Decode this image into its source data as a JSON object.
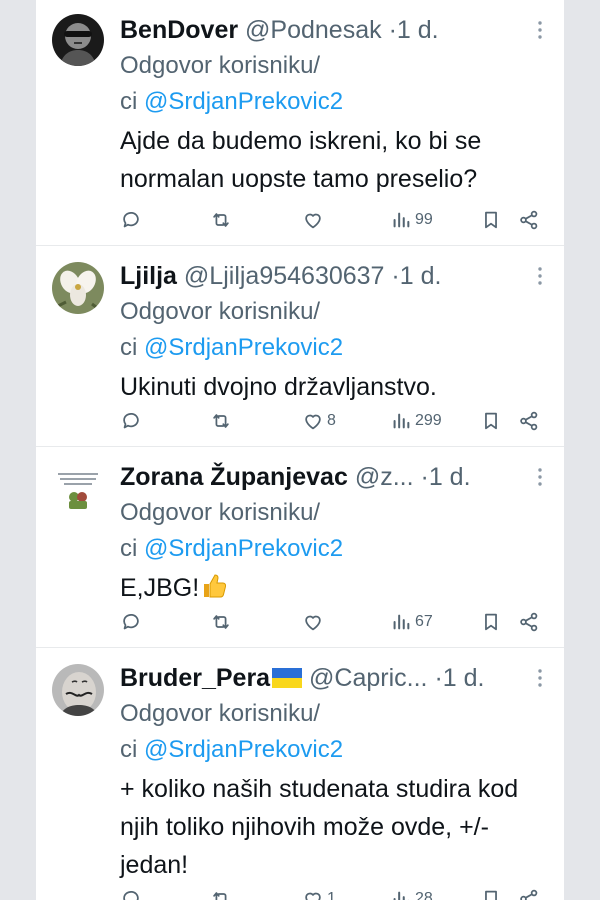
{
  "reply_prefix": "Odgovor korisniku/",
  "reply_line2_prefix": "ci ",
  "tweets": [
    {
      "name": "BenDover",
      "handle": "@Podnesak",
      "time": "1 d.",
      "mention": "@SrdjanPrekovic2",
      "text": "Ajde da budemo iskreni, ko bi se normalan uopste tamo preselio?",
      "replies": "",
      "retweets": "",
      "likes": "",
      "views": "99"
    },
    {
      "name": "Ljilja",
      "handle": "@Ljilja954630637",
      "time": "1 d.",
      "mention": "@SrdjanPrekovic2",
      "text": "Ukinuti dvojno državljanstvo.",
      "replies": "",
      "retweets": "",
      "likes": "8",
      "views": "299"
    },
    {
      "name": "Zorana Županjevac",
      "handle": "@z...",
      "time": "1 d.",
      "mention": "@SrdjanPrekovic2",
      "text": "E,JBG!",
      "replies": "",
      "retweets": "",
      "likes": "",
      "views": "67"
    },
    {
      "name": "Bruder_Pera",
      "handle": "@Capric...",
      "time": "1 d.",
      "mention": "@SrdjanPrekovic2",
      "text": "+ koliko naših studenata studira kod njih toliko njihovih može ovde, +/- jedan!",
      "replies": "",
      "retweets": "",
      "likes": "1",
      "views": "28"
    }
  ],
  "colors": {
    "text": "#0f1419",
    "secondary": "#536471",
    "accent": "#1d9bf0",
    "divider": "#e8eaec",
    "page_background": "#e4e6ea"
  },
  "icons": {
    "reply": "reply-icon",
    "retweet": "retweet-icon",
    "like": "like-icon",
    "views": "views-icon",
    "bookmark": "bookmark-icon",
    "share": "share-icon",
    "more": "more-icon",
    "flag": "ukraine-flag-icon",
    "emoji": "thumbs-up-emoji"
  }
}
